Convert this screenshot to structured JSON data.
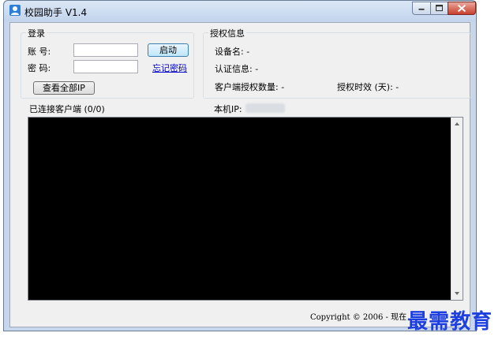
{
  "window": {
    "title": "校园助手 V1.4"
  },
  "login": {
    "group_label": "登录",
    "account_label": "账    号:",
    "password_label": "密    码:",
    "account_value": "",
    "password_value": "",
    "start_button": "启动",
    "forgot_link": "忘记密码",
    "view_all_ip_button": "查看全部IP"
  },
  "auth": {
    "group_label": "授权信息",
    "device_name_label": "设备名: -",
    "auth_info_label": "认证信息: -",
    "client_auth_count_label": "客户端授权数量: -",
    "auth_duration_label": "授权时效 (天): -"
  },
  "status": {
    "connected_clients_label": "已连接客户端 (0/0)",
    "local_ip_label": "本机IP:"
  },
  "footer": {
    "copyright": "Copyright © 2006 - 现在"
  },
  "watermark": {
    "text": "最需教育"
  },
  "colors": {
    "titlebar": "#c2d4ec",
    "console_bg": "#000000",
    "close_button": "#c9402d",
    "watermark": "#1d3fe0"
  }
}
